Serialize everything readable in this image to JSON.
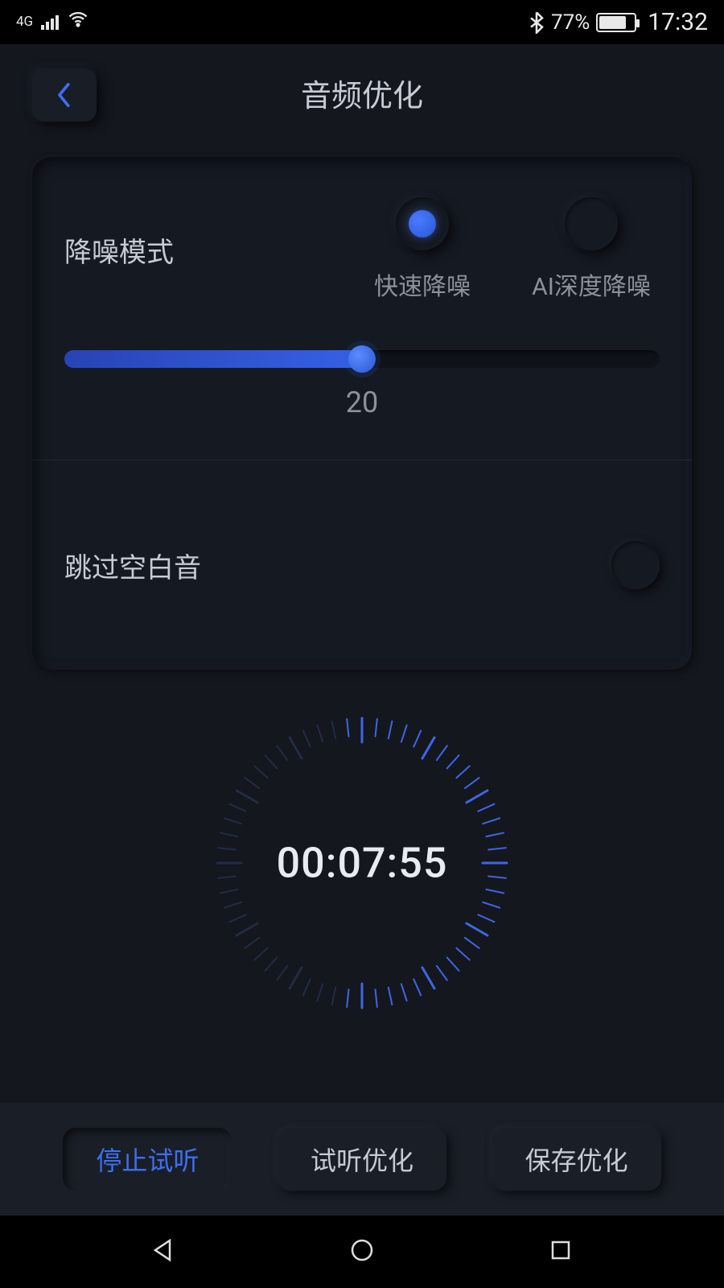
{
  "statusbar": {
    "network_type": "4G",
    "battery_percent": "77%",
    "time": "17:32"
  },
  "header": {
    "title": "音频优化"
  },
  "card": {
    "noise_mode_label": "降噪模式",
    "radio": {
      "fast": "快速降噪",
      "ai": "AI深度降噪",
      "selected": "fast"
    },
    "slider": {
      "value_label": "20",
      "percent": 50
    },
    "skip_silence_label": "跳过空白音",
    "skip_silence_on": false
  },
  "timer": {
    "display": "00:07:55"
  },
  "actions": {
    "stop": "停止试听",
    "preview": "试听优化",
    "save": "保存优化"
  }
}
